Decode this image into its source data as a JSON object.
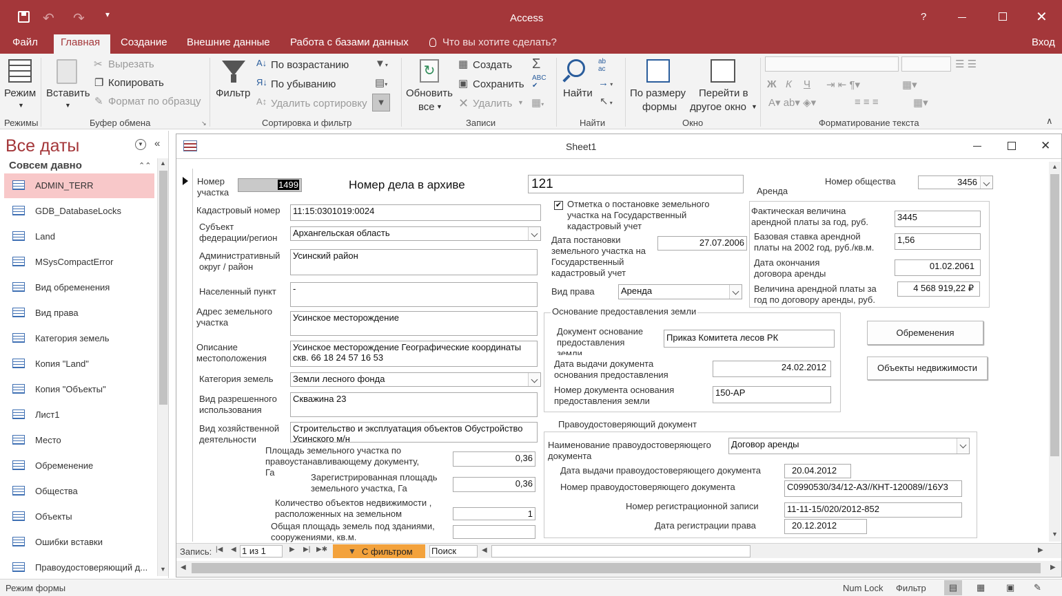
{
  "app": {
    "title": "Access",
    "help": "?",
    "signin": "Вход"
  },
  "menu": {
    "tabs": [
      "Файл",
      "Главная",
      "Создание",
      "Внешние данные",
      "Работа с базами данных"
    ],
    "search": "Что вы хотите сделать?"
  },
  "ribbon": {
    "views": {
      "mode": "Режим",
      "group": "Режимы"
    },
    "clipboard": {
      "paste": "Вставить",
      "cut": "Вырезать",
      "copy": "Копировать",
      "format_painter": "Формат по образцу",
      "group": "Буфер обмена"
    },
    "sort": {
      "filter": "Фильтр",
      "asc": "По возрастанию",
      "desc": "По убыванию",
      "remove": "Удалить сортировку",
      "group": "Сортировка и фильтр"
    },
    "records": {
      "refresh": "Обновить",
      "refresh2": "все",
      "new": "Создать",
      "save": "Сохранить",
      "delete": "Удалить",
      "group": "Записи"
    },
    "find": {
      "find": "Найти",
      "group": "Найти"
    },
    "window": {
      "fit": "По размеру",
      "fit2": "формы",
      "switch": "Перейти в",
      "switch2": "другое окно",
      "group": "Окно"
    },
    "format": {
      "group": "Форматирование текста"
    }
  },
  "nav": {
    "title": "Все даты",
    "section": "Совсем давно",
    "items": [
      "ADMIN_TERR",
      "GDB_DatabaseLocks",
      "Land",
      "MSysCompactError",
      "Вид обременения",
      "Вид права",
      "Категория земель",
      "Копия \"Land\"",
      "Копия \"Объекты\"",
      "Лист1",
      "Место",
      "Обременение",
      "Общества",
      "Объекты",
      "Ошибки вставки",
      "Правоудостоверяющий д..."
    ]
  },
  "form": {
    "title": "Sheet1",
    "lbl_plot": "Номер\nучастка",
    "plot_no": "1499",
    "lbl_archive": "Номер дела в архиве",
    "archive_no": "121",
    "lbl_society": "Номер общества",
    "society_no": "3456",
    "lbl_cad": "Кадастровый номер",
    "cad_no": "11:15:0301019:0024",
    "lbl_subject": "Субъект\nфедерации/регион",
    "subject": "Архангельская область",
    "lbl_district": "Административный\nокруг / район",
    "district": "Усинский район",
    "lbl_locality": "Населенный пункт",
    "locality": "-",
    "lbl_address": "Адрес земельного\nучастка",
    "address": "Усинское месторождение",
    "lbl_desc": "Описание\nместоположения",
    "desc": "Усинское месторождение Географические координаты скв. 66 18 24  57 16 53",
    "lbl_category": "Категория земель",
    "category": "Земли лесного фонда",
    "lbl_use": "Вид разрешенного\nиспользования",
    "use": "Скважина 23",
    "lbl_activity": "Вид хозяйственной\nдеятельности",
    "activity": "Строительство и эксплуатация объектов Обустройство Усинского м/н",
    "lbl_area_doc": "Площадь земельного участка по\nправоустанавливающему документу,\nГа",
    "area_doc": "0,36",
    "lbl_area_reg": "Зарегистрированная площадь\nземельного участка, Га",
    "area_reg": "0,36",
    "lbl_obj_count": "Количество объектов недвижимости ,\nрасположенных на земельном",
    "obj_count": "1",
    "lbl_build_area": "Общая площадь земель под зданиями,\nсооружениями, кв.м.",
    "build_area": "",
    "lbl_cad_flag": "Отметка о постановке земельного\nучастка на Государственный\nкадастровый учет",
    "lbl_cad_date": "Дата постановки\nземельного участка на\nГосударственный\nкадастровый учет",
    "cad_date": "27.07.2006",
    "lbl_right": "Вид права",
    "right": "Аренда",
    "lbl_rent_group": "Аренда",
    "lbl_rent_actual": "Фактическая величина\nарендной платы за год, руб.",
    "rent_actual": "3445",
    "lbl_rent_base": "Базовая ставка арендной\nплаты на 2002 год, руб./кв.м.",
    "rent_base": "1,56",
    "lbl_rent_end": "Дата окончания\nдоговора аренды",
    "rent_end": "01.02.2061",
    "lbl_rent_year": "Величина арендной платы за\nгод по договору аренды, руб.",
    "rent_year": "4 568 919,22 ₽",
    "lbl_basis_group": "Основание предоставления земли",
    "lbl_basis_doc": "Документ основание\nпредоставления\nземли",
    "basis_doc": "Приказ Комитета лесов РК",
    "lbl_basis_date": "Дата выдачи документа\nоснования предоставления",
    "basis_date": "24.02.2012",
    "lbl_basis_no": "Номер документа основания\nпредоставления земли",
    "basis_no": "150-АР",
    "btn_encumbrance": "Обременения",
    "btn_objects": "Объекты недвижимости",
    "lbl_title_group": "Правоудостоверяющий документ",
    "lbl_title_name": "Наименование правоудостоверяющего\nдокумента",
    "title_name": "Договор аренды",
    "lbl_title_date": "Дата выдачи правоудостоверяющего документа",
    "title_date": "20.04.2012",
    "lbl_title_no": "Номер правоудостоверяющего документа",
    "title_no": "С0990530/34/12-АЗ//КНТ-120089//16У3",
    "lbl_reg_no": "Номер регистрационной записи",
    "reg_no": "11-11-15/020/2012-852",
    "lbl_reg_date": "Дата регистрации права",
    "reg_date": "20.12.2012"
  },
  "recordnav": {
    "label": "Запись:",
    "position": "1 из 1",
    "filter": "С фильтром",
    "search": "Поиск"
  },
  "status": {
    "mode": "Режим формы",
    "numlock": "Num Lock",
    "filter": "Фильтр"
  },
  "colors": {
    "accent": "#a4373a",
    "selected": "#f8c8c9",
    "filter_badge": "#f3a23c"
  }
}
